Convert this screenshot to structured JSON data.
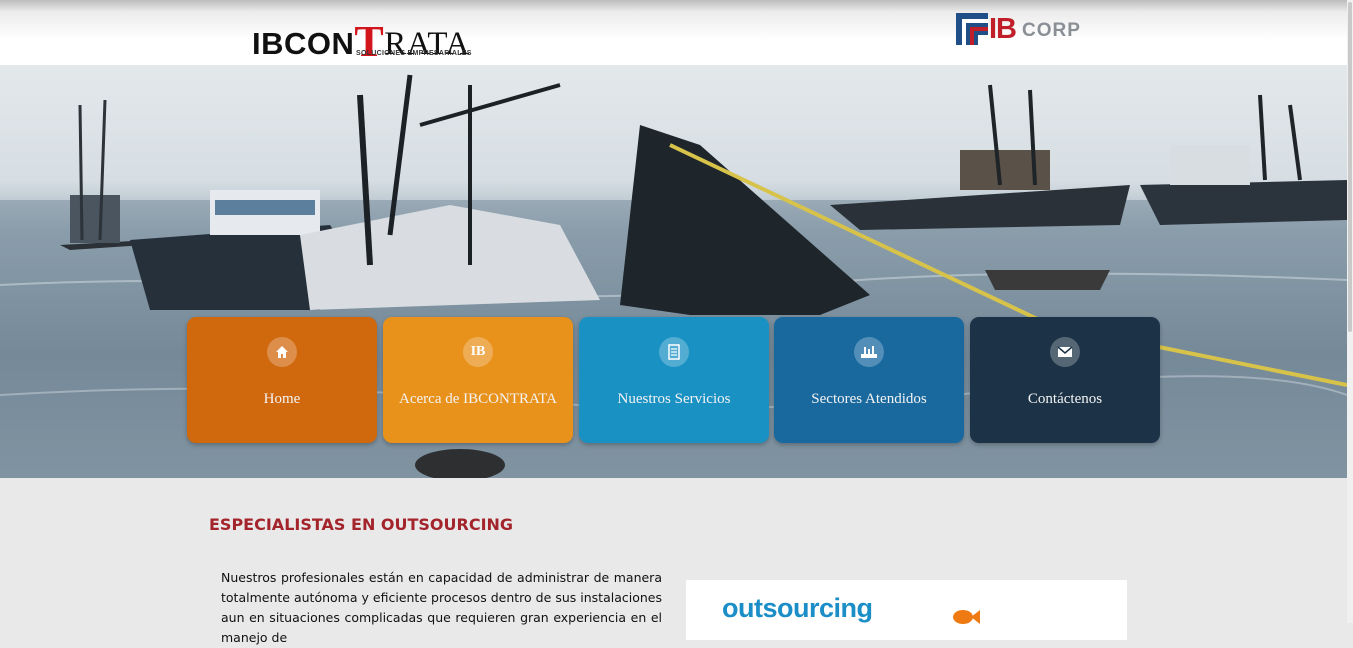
{
  "header": {
    "logo": {
      "main_prefix": "IBCON",
      "main_accent": "T",
      "main_suffix": "RATA",
      "tagline": "SOLUCIONES EMPRESARIALES"
    },
    "partner_logo": {
      "ib": "IB",
      "word": "CORP"
    }
  },
  "nav": {
    "items": [
      {
        "label": "Home",
        "icon": "home-icon",
        "color": "#d0690e"
      },
      {
        "label": "Acerca de IBCONTRATA",
        "icon": "ib-icon",
        "icon_text": "IB",
        "color": "#e8921c"
      },
      {
        "label": "Nuestros Servicios",
        "icon": "document-icon",
        "color": "#1a91c3"
      },
      {
        "label": "Sectores Atendidos",
        "icon": "industry-icon",
        "color": "#19699f"
      },
      {
        "label": "Contáctenos",
        "icon": "envelope-icon",
        "color": "#1c3347"
      }
    ]
  },
  "content": {
    "title": "ESPECIALISTAS EN OUTSOURCING",
    "paragraph": "Nuestros profesionales están en capacidad de administrar de manera totalmente autónoma y eficiente procesos dentro de sus instalaciones aun en situaciones complicadas que requieren gran experiencia en el manejo de",
    "promo_word": "outsourcing"
  }
}
